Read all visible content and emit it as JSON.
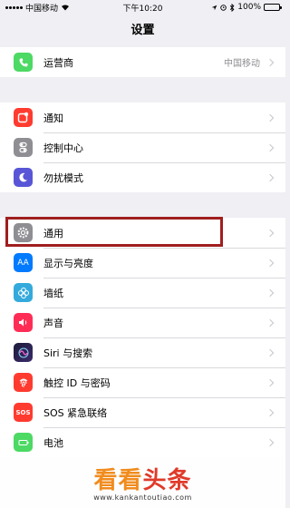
{
  "status_bar": {
    "carrier": "中国移动",
    "time": "下午10:20",
    "battery_text": "100%",
    "battery_level": 1.0
  },
  "nav": {
    "title": "设置"
  },
  "groups": [
    {
      "rows": [
        {
          "label": "运营商",
          "value": "中国移动",
          "icon": "phone-icon",
          "color": "#4cd964"
        }
      ]
    },
    {
      "rows": [
        {
          "label": "通知",
          "icon": "notification-icon",
          "color": "#ff3b30"
        },
        {
          "label": "控制中心",
          "icon": "toggle-icon",
          "color": "#8e8e93"
        },
        {
          "label": "勿扰模式",
          "icon": "moon-icon",
          "color": "#5856d6"
        }
      ]
    },
    {
      "rows": [
        {
          "label": "通用",
          "icon": "gear-icon",
          "color": "#8e8e93"
        },
        {
          "label": "显示与亮度",
          "icon": "text-size-icon",
          "color": "#007aff"
        },
        {
          "label": "墙纸",
          "icon": "flower-icon",
          "color": "#34aadc"
        },
        {
          "label": "声音",
          "icon": "speaker-icon",
          "color": "#ff2d55"
        },
        {
          "label": "Siri 与搜索",
          "icon": "siri-icon",
          "color": "#1c1c3a"
        },
        {
          "label": "触控 ID 与密码",
          "icon": "fingerprint-icon",
          "color": "#ff3b30"
        },
        {
          "label": "SOS 紧急联络",
          "icon": "sos-icon",
          "color": "#ff3b30"
        },
        {
          "label": "电池",
          "icon": "battery-icon",
          "color": "#4cd964"
        }
      ]
    }
  ],
  "icon_text": {
    "sos": "SOS",
    "text_size": "AA"
  },
  "watermark": {
    "title_a": "看看",
    "title_b": "头条",
    "url": "www.kankantoutiao.com"
  }
}
